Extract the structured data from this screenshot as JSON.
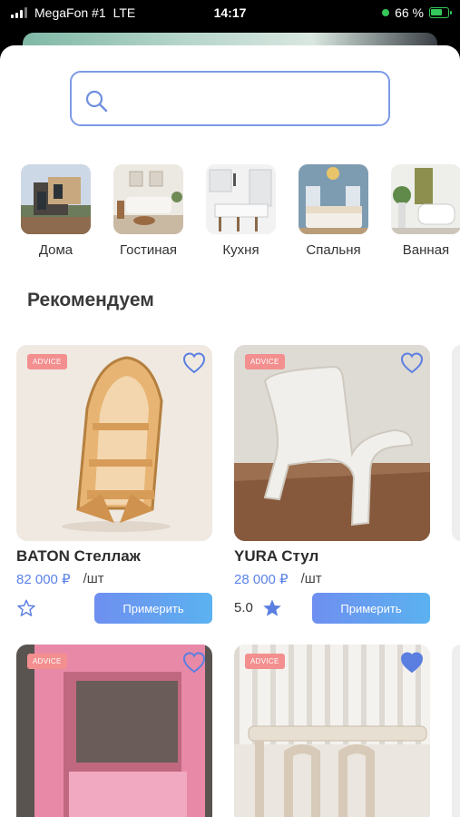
{
  "status_bar": {
    "carrier": "MegaFon #1",
    "network": "LTE",
    "time": "14:17",
    "battery": "66 %"
  },
  "search": {
    "placeholder": "",
    "value": ""
  },
  "categories": [
    {
      "label": "Дома"
    },
    {
      "label": "Гостиная"
    },
    {
      "label": "Кухня"
    },
    {
      "label": "Спальня"
    },
    {
      "label": "Ванная"
    }
  ],
  "section_title": "Рекомендуем",
  "products": [
    {
      "badge": "ADVICE",
      "name": "BATON Стеллаж",
      "price": "82 000 ₽",
      "unit": "/шт",
      "rating": "",
      "button": "Примерить",
      "favorite": false
    },
    {
      "badge": "ADVICE",
      "name": "YURA Стул",
      "price": "28 000 ₽",
      "unit": "/шт",
      "rating": "5.0",
      "button": "Примерить",
      "favorite": false
    },
    {
      "badge": "ADVICE",
      "name": "",
      "price": "",
      "unit": "",
      "rating": "",
      "button": "",
      "favorite": false
    },
    {
      "badge": "ADVICE",
      "name": "",
      "price": "",
      "unit": "",
      "rating": "",
      "button": "",
      "favorite": true
    }
  ],
  "colors": {
    "accent": "#5b82e8",
    "badge": "#f38f8f",
    "search_border": "#7d9ae6"
  }
}
